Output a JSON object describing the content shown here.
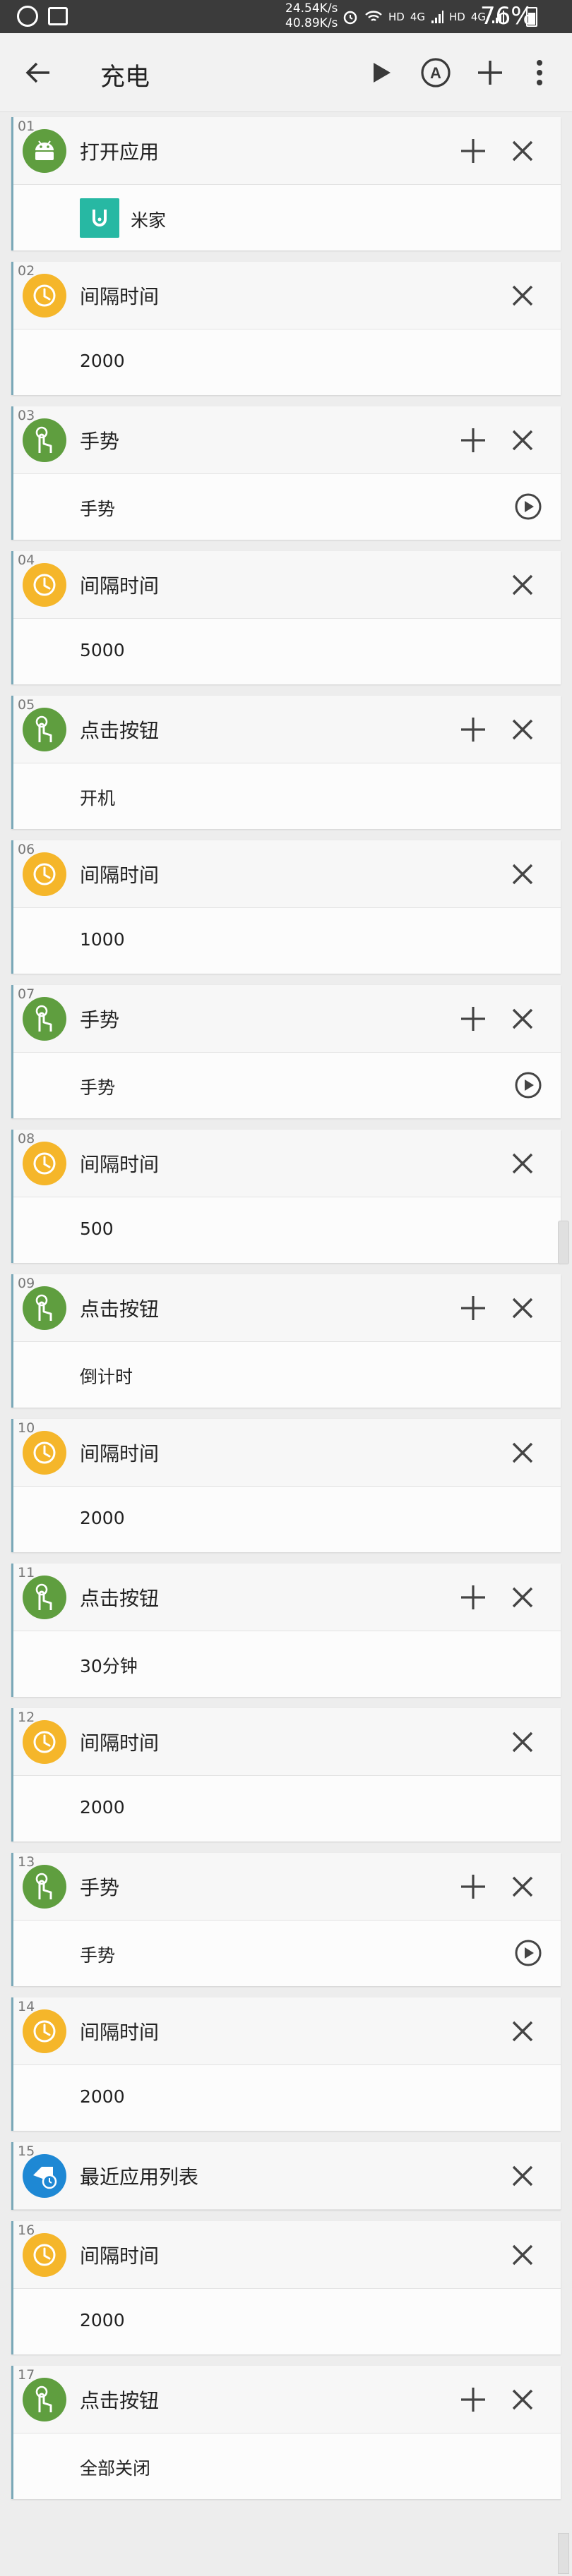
{
  "status_bar": {
    "speed_up": "24.54K/s",
    "speed_down": "40.89K/s",
    "network_labels": [
      "HD",
      "4G",
      "HD",
      "4G"
    ],
    "battery": "76%"
  },
  "toolbar": {
    "title": "充电",
    "back_icon": "arrow-left-icon",
    "play_icon": "play-icon",
    "auto_icon": "circle-a-icon",
    "auto_letter": "A",
    "add_icon": "plus-icon",
    "more_icon": "more-vert-icon"
  },
  "colors": {
    "green": "#5f9e3f",
    "yellow": "#f5b62a",
    "blue": "#1e88d4",
    "app_teal": "#27b8a3"
  },
  "steps": [
    {
      "num": "01",
      "title": "打开应用",
      "icon": "android-icon",
      "icon_color": "green",
      "has_add": true,
      "body_type": "app",
      "value": "米家"
    },
    {
      "num": "02",
      "title": "间隔时间",
      "icon": "clock-icon",
      "icon_color": "yellow",
      "has_add": false,
      "body_type": "text",
      "value": "2000"
    },
    {
      "num": "03",
      "title": "手势",
      "icon": "hand-tap-icon",
      "icon_color": "green",
      "has_add": true,
      "body_type": "gesture",
      "value": "手势"
    },
    {
      "num": "04",
      "title": "间隔时间",
      "icon": "clock-icon",
      "icon_color": "yellow",
      "has_add": false,
      "body_type": "text",
      "value": "5000"
    },
    {
      "num": "05",
      "title": "点击按钮",
      "icon": "hand-tap-icon",
      "icon_color": "green",
      "has_add": true,
      "body_type": "text",
      "value": "开机"
    },
    {
      "num": "06",
      "title": "间隔时间",
      "icon": "clock-icon",
      "icon_color": "yellow",
      "has_add": false,
      "body_type": "text",
      "value": "1000"
    },
    {
      "num": "07",
      "title": "手势",
      "icon": "hand-tap-icon",
      "icon_color": "green",
      "has_add": true,
      "body_type": "gesture",
      "value": "手势"
    },
    {
      "num": "08",
      "title": "间隔时间",
      "icon": "clock-icon",
      "icon_color": "yellow",
      "has_add": false,
      "body_type": "text",
      "value": "500"
    },
    {
      "num": "09",
      "title": "点击按钮",
      "icon": "hand-tap-icon",
      "icon_color": "green",
      "has_add": true,
      "body_type": "text",
      "value": "倒计时"
    },
    {
      "num": "10",
      "title": "间隔时间",
      "icon": "clock-icon",
      "icon_color": "yellow",
      "has_add": false,
      "body_type": "text",
      "value": "2000"
    },
    {
      "num": "11",
      "title": "点击按钮",
      "icon": "hand-tap-icon",
      "icon_color": "green",
      "has_add": true,
      "body_type": "text",
      "value": "30分钟"
    },
    {
      "num": "12",
      "title": "间隔时间",
      "icon": "clock-icon",
      "icon_color": "yellow",
      "has_add": false,
      "body_type": "text",
      "value": "2000"
    },
    {
      "num": "13",
      "title": "手势",
      "icon": "hand-tap-icon",
      "icon_color": "green",
      "has_add": true,
      "body_type": "gesture",
      "value": "手势"
    },
    {
      "num": "14",
      "title": "间隔时间",
      "icon": "clock-icon",
      "icon_color": "yellow",
      "has_add": false,
      "body_type": "text",
      "value": "2000"
    },
    {
      "num": "15",
      "title": "最近应用列表",
      "icon": "recent-apps-icon",
      "icon_color": "blue",
      "has_add": false,
      "body_type": "none",
      "value": ""
    },
    {
      "num": "16",
      "title": "间隔时间",
      "icon": "clock-icon",
      "icon_color": "yellow",
      "has_add": false,
      "body_type": "text",
      "value": "2000"
    },
    {
      "num": "17",
      "title": "点击按钮",
      "icon": "hand-tap-icon",
      "icon_color": "green",
      "has_add": true,
      "body_type": "text",
      "value": "全部关闭"
    }
  ]
}
